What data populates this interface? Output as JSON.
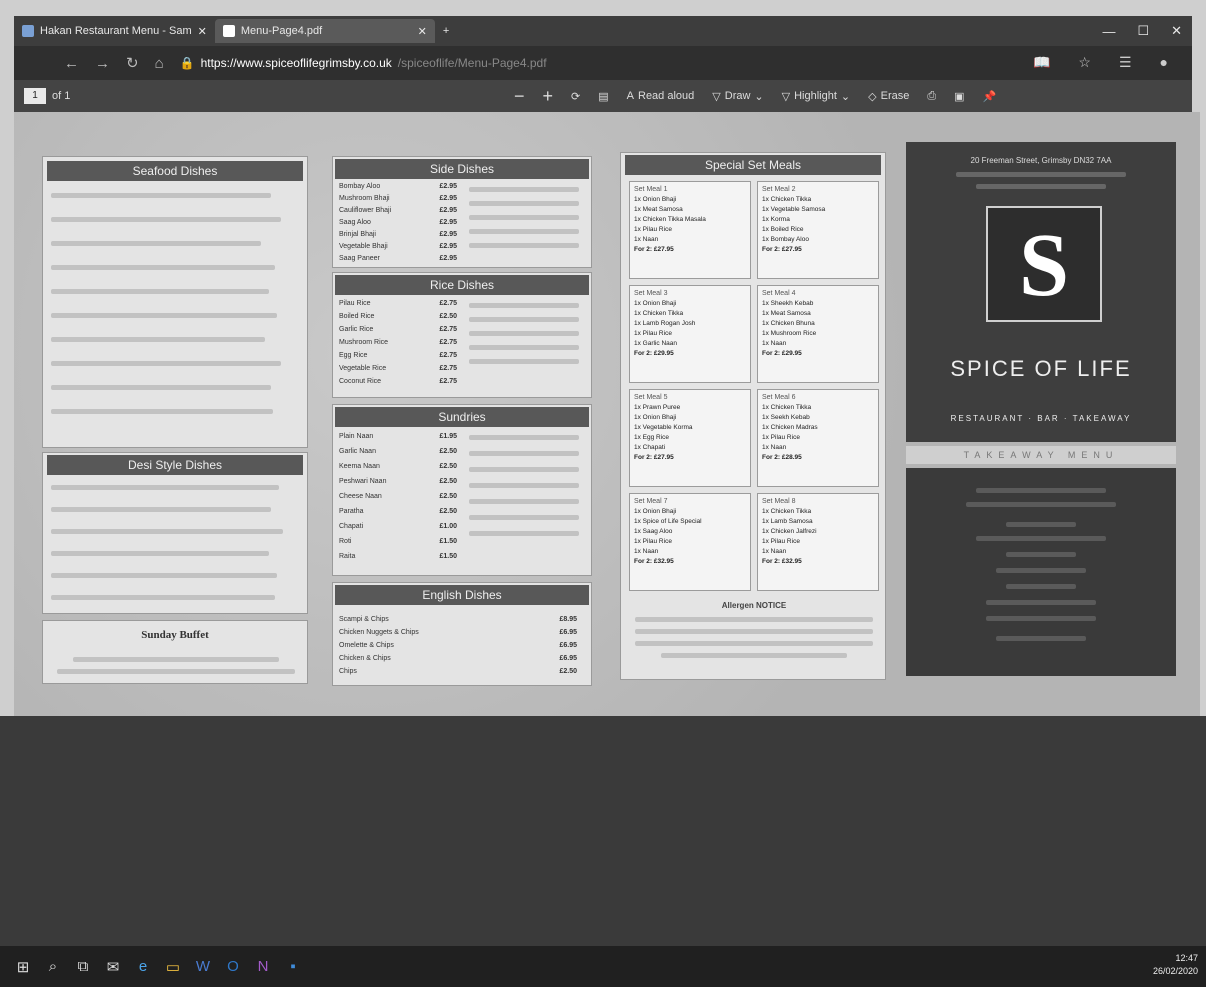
{
  "browser": {
    "tabs": [
      {
        "label": "Hakan Restaurant Menu - Sam"
      },
      {
        "label": "Menu-Page4.pdf"
      }
    ],
    "new_tab": "+",
    "url_domain": "https://www.spiceoflifegrimsby.co.uk",
    "url_path": "/spiceoflife/Menu-Page4.pdf"
  },
  "pdf_toolbar": {
    "page_current": "1",
    "page_total": "of 1",
    "zoom_out": "−",
    "zoom_in": "+",
    "read_aloud": "Read aloud",
    "draw": "Draw",
    "highlight": "Highlight",
    "erase": "Erase"
  },
  "menu": {
    "seafood": {
      "title": "Seafood Dishes"
    },
    "desi": {
      "title": "Desi Style Dishes"
    },
    "buffet": {
      "title": "Sunday Buffet"
    },
    "side": {
      "title": "Side Dishes",
      "items": [
        {
          "name": "Bombay Aloo",
          "price": "£2.95"
        },
        {
          "name": "Mushroom Bhaji",
          "price": "£2.95"
        },
        {
          "name": "Cauliflower Bhaji",
          "price": "£2.95"
        },
        {
          "name": "Saag Aloo",
          "price": "£2.95"
        },
        {
          "name": "Brinjal Bhaji",
          "price": "£2.95"
        },
        {
          "name": "Vegetable Bhaji",
          "price": "£2.95"
        },
        {
          "name": "Saag Paneer",
          "price": "£2.95"
        }
      ]
    },
    "rice": {
      "title": "Rice Dishes",
      "items": [
        {
          "name": "Pilau Rice",
          "price": "£2.75"
        },
        {
          "name": "Boiled Rice",
          "price": "£2.50"
        },
        {
          "name": "Garlic Rice",
          "price": "£2.75"
        },
        {
          "name": "Mushroom Rice",
          "price": "£2.75"
        },
        {
          "name": "Egg Rice",
          "price": "£2.75"
        },
        {
          "name": "Vegetable Rice",
          "price": "£2.75"
        },
        {
          "name": "Coconut Rice",
          "price": "£2.75"
        }
      ]
    },
    "sundries": {
      "title": "Sundries",
      "items": [
        {
          "name": "Plain Naan",
          "price": "£1.95"
        },
        {
          "name": "Garlic Naan",
          "price": "£2.50"
        },
        {
          "name": "Keema Naan",
          "price": "£2.50"
        },
        {
          "name": "Peshwari Naan",
          "price": "£2.50"
        },
        {
          "name": "Cheese Naan",
          "price": "£2.50"
        },
        {
          "name": "Paratha",
          "price": "£2.50"
        },
        {
          "name": "Chapati",
          "price": "£1.00"
        },
        {
          "name": "Roti",
          "price": "£1.50"
        },
        {
          "name": "Raita",
          "price": "£1.50"
        }
      ]
    },
    "english": {
      "title": "English Dishes",
      "items": [
        {
          "name": "Scampi & Chips",
          "price": "£8.95"
        },
        {
          "name": "Chicken Nuggets & Chips",
          "price": "£6.95"
        },
        {
          "name": "Omelette & Chips",
          "price": "£6.95"
        },
        {
          "name": "Chicken & Chips",
          "price": "£6.95"
        },
        {
          "name": "Chips",
          "price": "£2.50"
        }
      ]
    },
    "sets": {
      "title": "Special Set Meals",
      "boxes": [
        {
          "name": "Set Meal 1",
          "lines": [
            "1x Onion Bhaji",
            "1x Meat Samosa",
            "1x Chicken Tikka Masala",
            "1x Pilau Rice",
            "1x Naan",
            "For 2: £27.95"
          ]
        },
        {
          "name": "Set Meal 2",
          "lines": [
            "1x Chicken Tikka",
            "1x Vegetable Samosa",
            "1x Korma",
            "1x Boiled Rice",
            "1x Bombay Aloo",
            "For 2: £27.95"
          ]
        },
        {
          "name": "Set Meal 3",
          "lines": [
            "1x Onion Bhaji",
            "1x Chicken Tikka",
            "1x Lamb Rogan Josh",
            "1x Pilau Rice",
            "1x Garlic Naan",
            "For 2: £29.95"
          ]
        },
        {
          "name": "Set Meal 4",
          "lines": [
            "1x Sheekh Kebab",
            "1x Meat Samosa",
            "1x Chicken Bhuna",
            "1x Mushroom Rice",
            "1x Naan",
            "For 2: £29.95"
          ]
        },
        {
          "name": "Set Meal 5",
          "lines": [
            "1x Prawn Puree",
            "1x Onion Bhaji",
            "1x Vegetable Korma",
            "1x Egg Rice",
            "1x Chapati",
            "For 2: £27.95"
          ]
        },
        {
          "name": "Set Meal 6",
          "lines": [
            "1x Chicken Tikka",
            "1x Seekh Kebab",
            "1x Chicken Madras",
            "1x Pilau Rice",
            "1x Naan",
            "For 2: £28.95"
          ]
        },
        {
          "name": "Set Meal 7",
          "lines": [
            "1x Onion Bhaji",
            "1x Spice of Life Special",
            "1x Saag Aloo",
            "1x Pilau Rice",
            "1x Naan",
            "For 2: £32.95"
          ]
        },
        {
          "name": "Set Meal 8",
          "lines": [
            "1x Chicken Tikka",
            "1x Lamb Samosa",
            "1x Chicken Jalfrezi",
            "1x Pilau Rice",
            "1x Naan",
            "For 2: £32.95"
          ]
        }
      ],
      "notice": "Allergen NOTICE"
    }
  },
  "brand": {
    "address": "20 Freeman Street, Grimsby DN32 7AA",
    "letter": "S",
    "name": "SPICE OF LIFE",
    "tagline": "RESTAURANT · BAR · TAKEAWAY",
    "takeaway_strip": "TAKEAWAY MENU"
  },
  "clock": {
    "time": "12:47",
    "date": "26/02/2020"
  }
}
